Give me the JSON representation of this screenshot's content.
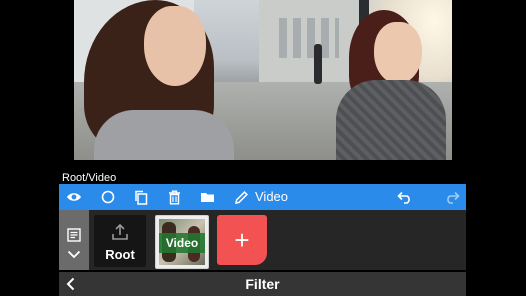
{
  "breadcrumb": {
    "path": "Root/Video"
  },
  "toolbar": {
    "visibility_icon": "eye-icon",
    "mask_icon": "circle-icon",
    "copy_icon": "copy-icon",
    "delete_icon": "trash-icon",
    "folder_icon": "folder-icon",
    "edit_icon": "pencil-icon",
    "video_label": "Video",
    "undo_icon": "undo-icon",
    "redo_icon": "redo-icon",
    "color": "#2b8bea"
  },
  "timeline": {
    "tiles": [
      {
        "label": "Root",
        "icon": "upload-icon"
      },
      {
        "label": "Video"
      }
    ],
    "add_label": "+",
    "add_color": "#f35252"
  },
  "bottom_bar": {
    "title": "Filter",
    "back_icon": "chevron-left-icon"
  }
}
